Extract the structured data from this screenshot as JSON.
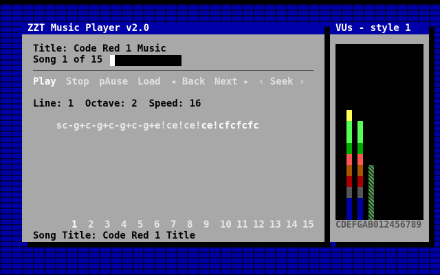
{
  "player": {
    "window_title": "ZZT Music Player v2.0",
    "title_label": "Title: Code Red 1 Music",
    "song_label": "Song 1 of 15",
    "progress": 0.07,
    "controls": [
      {
        "label": "Play",
        "active": true
      },
      {
        "label": "Stop",
        "active": false
      },
      {
        "label": "pAuse",
        "active": false
      },
      {
        "label": "Load",
        "active": false
      },
      {
        "label": "◂ Back",
        "active": false
      },
      {
        "label": "Next ▸",
        "active": false
      },
      {
        "label": "‹ Seek ›",
        "active": false
      }
    ],
    "line_info": "Line: 1  Octave: 2  Speed: 16",
    "sequence_played": "sc-g+c-g+c-g+c-g+e!ce!ce!",
    "sequence_current": "c",
    "sequence_upcoming": "e!cfcfcfc",
    "song_numbers": [
      "1",
      "2",
      "3",
      "4",
      "5",
      "6",
      "7",
      "8",
      "9",
      "10",
      "11",
      "12",
      "13",
      "14",
      "15"
    ],
    "selected_song": "1",
    "song_title": "Song Title: Code Red 1 Title"
  },
  "vu": {
    "window_title": "VUs - style 1",
    "labels": "CDEFGAB012456789",
    "levels": [
      8,
      7,
      3
    ],
    "colors": {
      "yellow": "#ffff55",
      "lightgreen": "#55ff55",
      "green": "#00a800",
      "lightred": "#ff5555",
      "brown": "#a85400",
      "red": "#a80000",
      "gray": "#555555",
      "blue": "#0000a8"
    }
  }
}
